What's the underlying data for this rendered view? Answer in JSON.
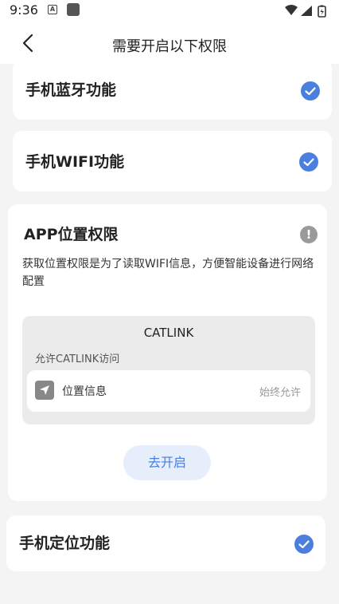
{
  "status_bar": {
    "time": "9:36",
    "notif_a": "A"
  },
  "nav": {
    "title": "需要开启以下权限"
  },
  "permissions": {
    "bluetooth": {
      "title": "手机蓝牙功能"
    },
    "wifi": {
      "title": "手机WIFI功能"
    },
    "location_perm": {
      "title": "APP位置权限",
      "description": "获取位置权限是为了读取WIFI信息，方便智能设备进行网络配置",
      "dialog": {
        "app_name": "CATLINK",
        "subtitle": "允许CATLINK访问",
        "row_label": "位置信息",
        "row_value": "始终允许"
      },
      "button_label": "去开启"
    },
    "location": {
      "title": "手机定位功能"
    }
  },
  "colors": {
    "accent": "#4a7fe0",
    "info": "#9a9a9a",
    "background": "#f4f4f4"
  },
  "icons": {
    "back": "chevron-left-icon",
    "check": "check-circle-icon",
    "info": "info-icon",
    "location": "location-arrow-icon"
  }
}
